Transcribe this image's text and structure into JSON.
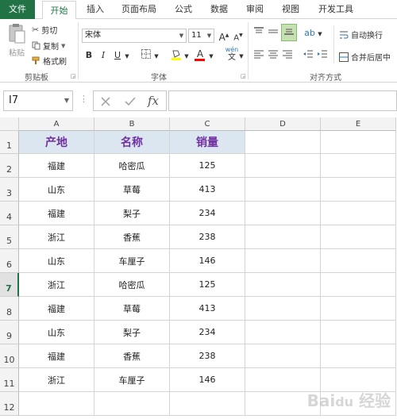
{
  "menu": {
    "tabs": [
      "文件",
      "开始",
      "插入",
      "页面布局",
      "公式",
      "数据",
      "审阅",
      "视图",
      "开发工具"
    ]
  },
  "ribbon": {
    "clipboard": {
      "paste": "粘贴",
      "cut": "剪切",
      "copy": "复制",
      "format_painter": "格式刷",
      "group": "剪贴板"
    },
    "font": {
      "name": "宋体",
      "size": "11",
      "bold": "B",
      "italic": "I",
      "underline": "U",
      "grow": "A",
      "shrink": "A",
      "font_color_letter": "A",
      "phonetic": "wén",
      "group": "字体"
    },
    "alignment": {
      "wrap_text": "自动换行",
      "merge_center": "合并后居中",
      "group": "对齐方式"
    }
  },
  "formula_bar": {
    "name_box": "I7",
    "fx": "fx",
    "formula": ""
  },
  "grid": {
    "columns": [
      "A",
      "B",
      "C",
      "D",
      "E"
    ],
    "rows": [
      "1",
      "2",
      "3",
      "4",
      "5",
      "6",
      "7",
      "8",
      "9",
      "10",
      "11",
      "12"
    ],
    "selected_row": "7",
    "header": [
      "产地",
      "名称",
      "销量"
    ],
    "data": [
      [
        "福建",
        "哈密瓜",
        "125"
      ],
      [
        "山东",
        "草莓",
        "413"
      ],
      [
        "福建",
        "梨子",
        "234"
      ],
      [
        "浙江",
        "香蕉",
        "238"
      ],
      [
        "山东",
        "车厘子",
        "146"
      ],
      [
        "浙江",
        "哈密瓜",
        "125"
      ],
      [
        "福建",
        "草莓",
        "413"
      ],
      [
        "山东",
        "梨子",
        "234"
      ],
      [
        "福建",
        "香蕉",
        "238"
      ],
      [
        "浙江",
        "车厘子",
        "146"
      ]
    ]
  },
  "colors": {
    "accent": "#217346",
    "header_fill": "#dce6f1",
    "header_text": "#7030a0"
  }
}
